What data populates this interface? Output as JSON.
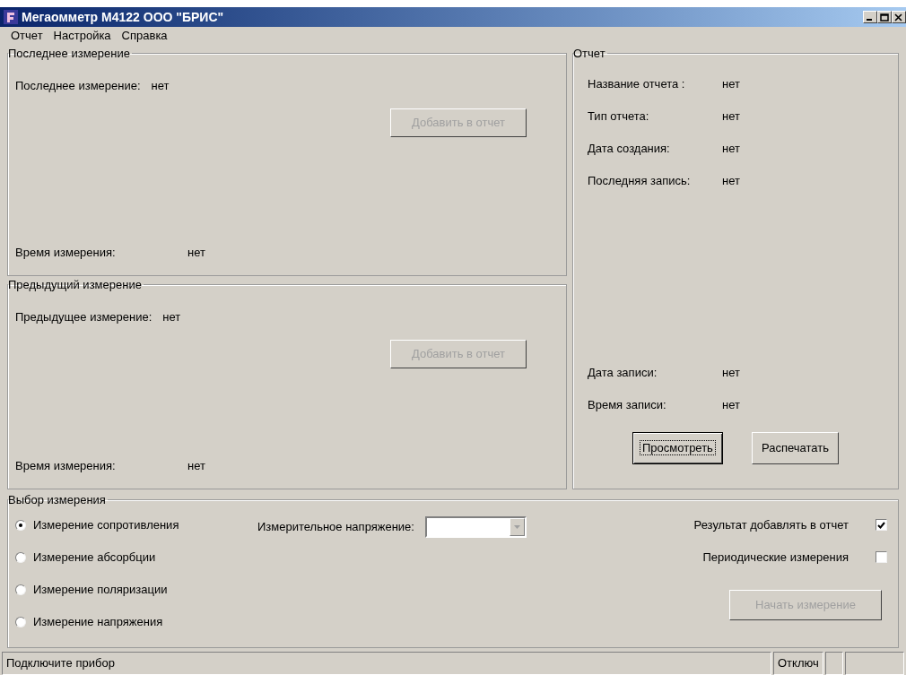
{
  "window": {
    "title": "Мегаомметр М4122  ООО \"БРИС\""
  },
  "menu": [
    {
      "label": "Отчет"
    },
    {
      "label": "Настройка"
    },
    {
      "label": "Справка"
    }
  ],
  "last_measurement": {
    "title": "Последнее измерение",
    "label": "Последнее измерение:",
    "value": "нет",
    "add_button": {
      "label": "Добавить в отчет",
      "disabled": true
    },
    "time_label": "Время измерения:",
    "time_value": "нет"
  },
  "previous_measurement": {
    "title": "Предыдущий измерение",
    "label": "Предыдущее измерение:",
    "value": "нет",
    "add_button": {
      "label": "Добавить в отчет",
      "disabled": true
    },
    "time_label": "Время измерения:",
    "time_value": "нет"
  },
  "report": {
    "title": "Отчет",
    "fields": [
      {
        "label": "Название отчета :",
        "value": "нет"
      },
      {
        "label": "Тип отчета:",
        "value": "нет"
      },
      {
        "label": "Дата создания:",
        "value": "нет"
      },
      {
        "label": "Последняя запись:",
        "value": "нет"
      }
    ],
    "record_fields": [
      {
        "label": "Дата записи:",
        "value": "нет"
      },
      {
        "label": "Время записи:",
        "value": "нет"
      }
    ],
    "buttons": [
      {
        "label": "Просмотреть",
        "focused": true
      },
      {
        "label": "Распечатать",
        "focused": false
      }
    ]
  },
  "selection": {
    "title": "Выбор измерения",
    "options": [
      {
        "label": "Измерение сопротивления",
        "selected": true
      },
      {
        "label": "Измерение абсорбции",
        "selected": false
      },
      {
        "label": "Измерение поляризации",
        "selected": false
      },
      {
        "label": "Измерение напряжения",
        "selected": false
      }
    ],
    "voltage_label": "Измерительное напряжение:",
    "checks": [
      {
        "label": "Результат добавлять в отчет",
        "checked": true
      },
      {
        "label": "Периодические измерения",
        "checked": false
      }
    ],
    "start_button": {
      "label": "Начать измерение",
      "disabled": true
    }
  },
  "status_bar": {
    "message": "Подключите прибор",
    "panels": [
      "Отключ"
    ]
  }
}
